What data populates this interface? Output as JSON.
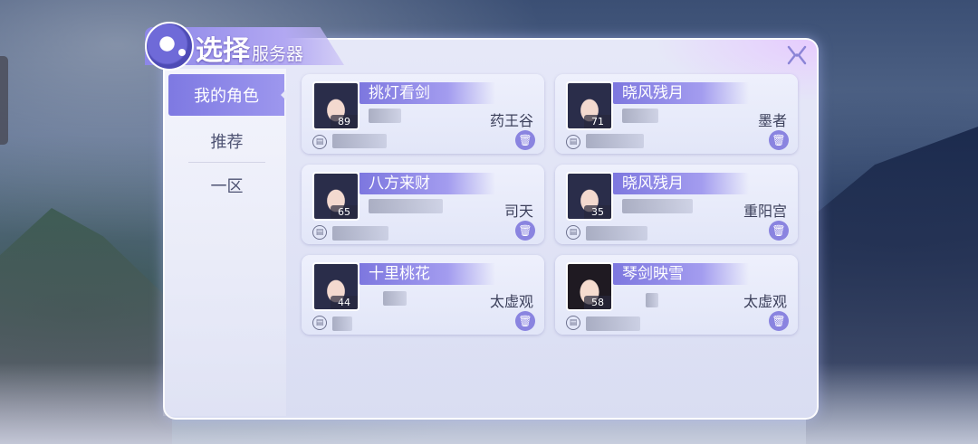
{
  "header": {
    "title_big": "选择",
    "title_small": "服务器"
  },
  "close": {
    "icon": "close-x-icon"
  },
  "sidebar": {
    "items": [
      {
        "label": "我的角色",
        "active": true
      },
      {
        "label": "推荐",
        "active": false
      },
      {
        "label": "一区",
        "active": false
      }
    ]
  },
  "characters": [
    {
      "name": "挑灯看剑",
      "level": "89",
      "sect": "药王谷",
      "avatar": "male-character-avatar"
    },
    {
      "name": "晓风残月",
      "level": "71",
      "sect": "墨者",
      "avatar": "male-character-avatar"
    },
    {
      "name": "八方来财",
      "level": "65",
      "sect": "司天",
      "avatar": "male-character-avatar"
    },
    {
      "name": "晓风残月",
      "level": "35",
      "sect": "重阳宫",
      "avatar": "male-character-avatar"
    },
    {
      "name": "十里桃花",
      "level": "44",
      "sect": "太虚观",
      "avatar": "male-character-avatar"
    },
    {
      "name": "琴剑映雪",
      "level": "58",
      "sect": "太虚观",
      "avatar": "female-character-avatar"
    }
  ],
  "colors": {
    "accent": "#7e79e2",
    "panel": "#e6e8f8",
    "text_dark": "#3b3f5a"
  }
}
